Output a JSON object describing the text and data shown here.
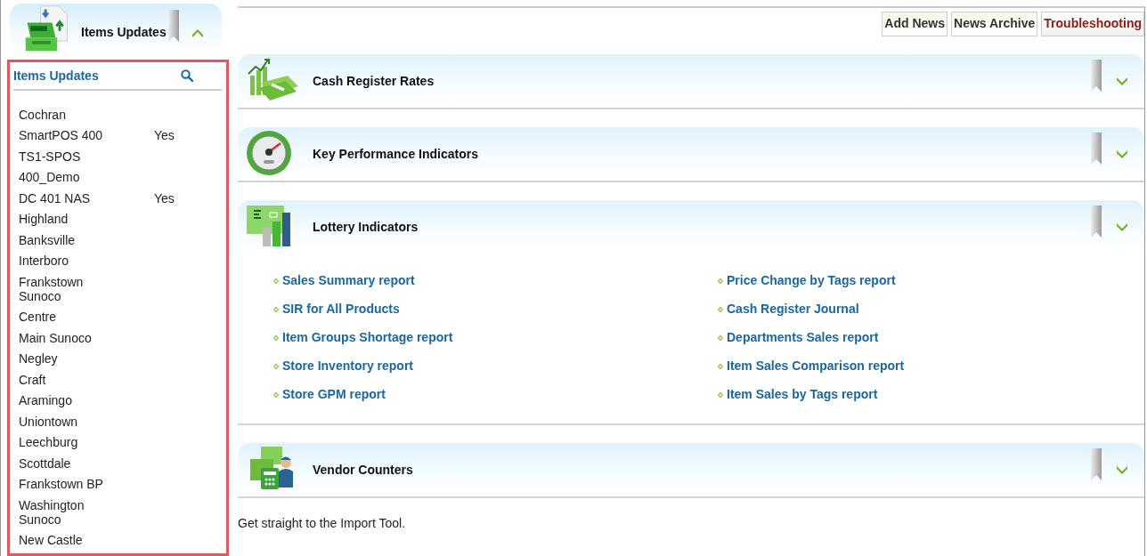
{
  "sidebar": {
    "header": {
      "title": "Items Updates",
      "expanded": true
    },
    "panel": {
      "title": "Items Updates",
      "stores": [
        {
          "name": "Cochran"
        },
        {
          "name": "SmartPOS 400",
          "value": "Yes"
        },
        {
          "name": "TS1-SPOS"
        },
        {
          "name": "400_Demo"
        },
        {
          "name": "DC 401 NAS",
          "value": "Yes"
        },
        {
          "name": "Highland"
        },
        {
          "name": "Banksville"
        },
        {
          "name": "Interboro"
        },
        {
          "name": "Frankstown Sunoco"
        },
        {
          "name": "Centre"
        },
        {
          "name": "Main Sunoco"
        },
        {
          "name": "Negley"
        },
        {
          "name": "Craft"
        },
        {
          "name": "Aramingo"
        },
        {
          "name": "Uniontown"
        },
        {
          "name": "Leechburg"
        },
        {
          "name": "Scottdale"
        },
        {
          "name": "Frankstown BP"
        },
        {
          "name": "Washington Sunoco"
        },
        {
          "name": "New Castle"
        }
      ]
    }
  },
  "toolbar": {
    "buttons": [
      {
        "label": "Add News",
        "kind": "normal"
      },
      {
        "label": "News Archive",
        "kind": "normal"
      },
      {
        "label": "Troubleshooting",
        "kind": "alert"
      }
    ]
  },
  "sections": [
    {
      "title": "Cash Register Rates",
      "kind": "rates",
      "expanded": false
    },
    {
      "title": "Key Performance Indicators",
      "kind": "gauge",
      "expanded": false
    },
    {
      "title": "Lottery Indicators",
      "kind": "lottery",
      "expanded": false,
      "links": [
        "Sales Summary report",
        "Price Change by Tags report",
        "SIR for All Products",
        "Cash Register Journal",
        "Item Groups Shortage report",
        "Departments Sales report",
        "Store Inventory report",
        "Item Sales Comparison report",
        "Store GPM report",
        "Item Sales by Tags report"
      ]
    },
    {
      "title": "Vendor Counters",
      "kind": "vendor",
      "expanded": false
    }
  ],
  "footer": "Get straight to the Import Tool."
}
